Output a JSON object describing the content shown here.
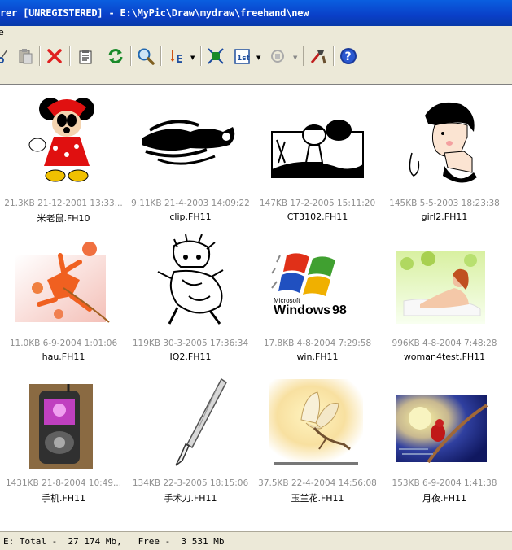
{
  "window": {
    "title": "rer [UNREGISTERED] - E:\\MyPic\\Draw\\mydraw\\freehand\\new"
  },
  "menubar": {
    "partial_label": "e"
  },
  "toolbar": {
    "icons": [
      "cut-icon",
      "paste-icon",
      "delete-icon",
      "properties-icon",
      "refresh-icon",
      "zoom-icon",
      "sort-icon",
      "fit-icon",
      "first-icon",
      "rotate-icon",
      "tools-icon",
      "help-icon"
    ],
    "first_label": "1st",
    "help_label": "?"
  },
  "files": [
    {
      "size": "21.3KB",
      "date": "21-12-2001 13:33...",
      "name": "米老鼠.FH10"
    },
    {
      "size": "9.11KB",
      "date": "21-4-2003 14:09:22",
      "name": "clip.FH11"
    },
    {
      "size": "147KB",
      "date": "17-2-2005 15:11:20",
      "name": "CT3102.FH11"
    },
    {
      "size": "145KB",
      "date": "5-5-2003 18:23:38",
      "name": "girl2.FH11"
    },
    {
      "size": "11.0KB",
      "date": "6-9-2004 1:01:06",
      "name": "hau.FH11"
    },
    {
      "size": "119KB",
      "date": "30-3-2005 17:36:34",
      "name": "IQ2.FH11"
    },
    {
      "size": "17.8KB",
      "date": "4-8-2004 7:29:58",
      "name": "win.FH11"
    },
    {
      "size": "996KB",
      "date": "4-8-2004 7:48:28",
      "name": "woman4test.FH11"
    },
    {
      "size": "1431KB",
      "date": "21-8-2004 10:49...",
      "name": "手机.FH11"
    },
    {
      "size": "134KB",
      "date": "22-3-2005 18:15:06",
      "name": "手术刀.FH11"
    },
    {
      "size": "37.5KB",
      "date": "22-4-2004 14:56:08",
      "name": "玉兰花.FH11"
    },
    {
      "size": "153KB",
      "date": "6-9-2004 1:41:38",
      "name": "月夜.FH11"
    }
  ],
  "thumb_text": {
    "win_small": "Microsoft",
    "win_big": "Windows",
    "win_num": "98"
  },
  "status": {
    "text": "E: Total -  27 174 Mb,   Free -  3 531 Mb"
  }
}
